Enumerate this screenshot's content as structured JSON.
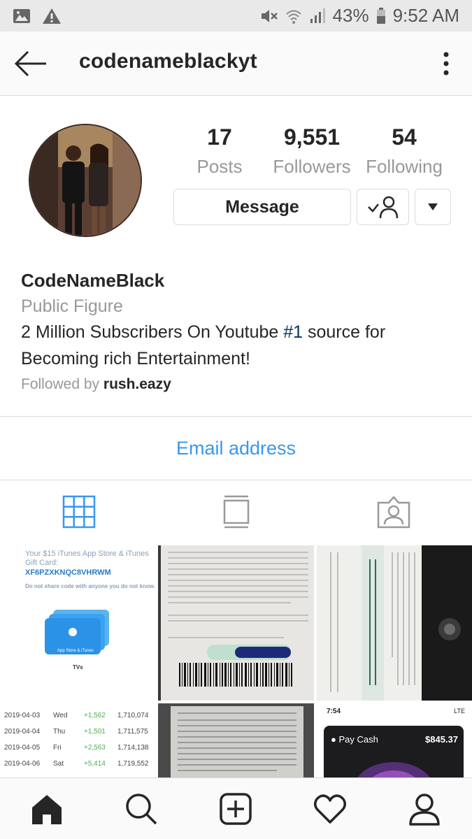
{
  "status_bar": {
    "battery": "43%",
    "time": "9:52 AM",
    "icons": [
      "gallery-icon",
      "warning-icon",
      "mute-icon",
      "wifi-icon",
      "signal-icon",
      "battery-icon"
    ]
  },
  "header": {
    "username": "codenameblackyt",
    "back_icon": "back-arrow-icon",
    "more_icon": "more-vertical-icon"
  },
  "profile": {
    "stats": [
      {
        "value": "17",
        "label": "Posts"
      },
      {
        "value": "9,551",
        "label": "Followers"
      },
      {
        "value": "54",
        "label": "Following"
      }
    ],
    "buttons": {
      "message": "Message"
    },
    "name": "CodeNameBlack",
    "category": "Public Figure",
    "bio_before": "2 Million Subscribers On Youtube ",
    "bio_tag": "#1",
    "bio_after": " source for Becoming rich Entertainment!",
    "followed_by_prefix": "Followed by ",
    "followed_by_user": "rush.eazy",
    "email_button": "Email address"
  },
  "tabs": [
    "grid-icon",
    "feed-icon",
    "tagged-icon"
  ],
  "posts": {
    "gift_card": {
      "title_line1": "Your $15 iTunes App Store & iTunes",
      "title_line2": "Gift Card:",
      "code": "XF6PZXKNQC8VHRWM",
      "warning": "Do not share code with anyone you do not know.",
      "card_label": "App Store & iTunes",
      "footer": "TVs"
    },
    "stats_table": [
      [
        "2019-04-03",
        "Wed",
        "+1,562",
        "1,710,074"
      ],
      [
        "2019-04-04",
        "Thu",
        "+1,501",
        "1,711,575"
      ],
      [
        "2019-04-05",
        "Fri",
        "+2,563",
        "1,714,138"
      ],
      [
        "2019-04-06",
        "Sat",
        "+5,414",
        "1,719,552"
      ]
    ],
    "apple_pay": {
      "time": "7:54",
      "network": "LTE",
      "label": "Pay Cash",
      "amount": "$845.37"
    }
  },
  "colors": {
    "accent": "#3897f0",
    "tag": "#003569",
    "gray_text": "#999999",
    "border": "#dbdbdb"
  },
  "bottom_nav": [
    "home-icon",
    "search-icon",
    "add-post-icon",
    "activity-heart-icon",
    "profile-icon"
  ]
}
